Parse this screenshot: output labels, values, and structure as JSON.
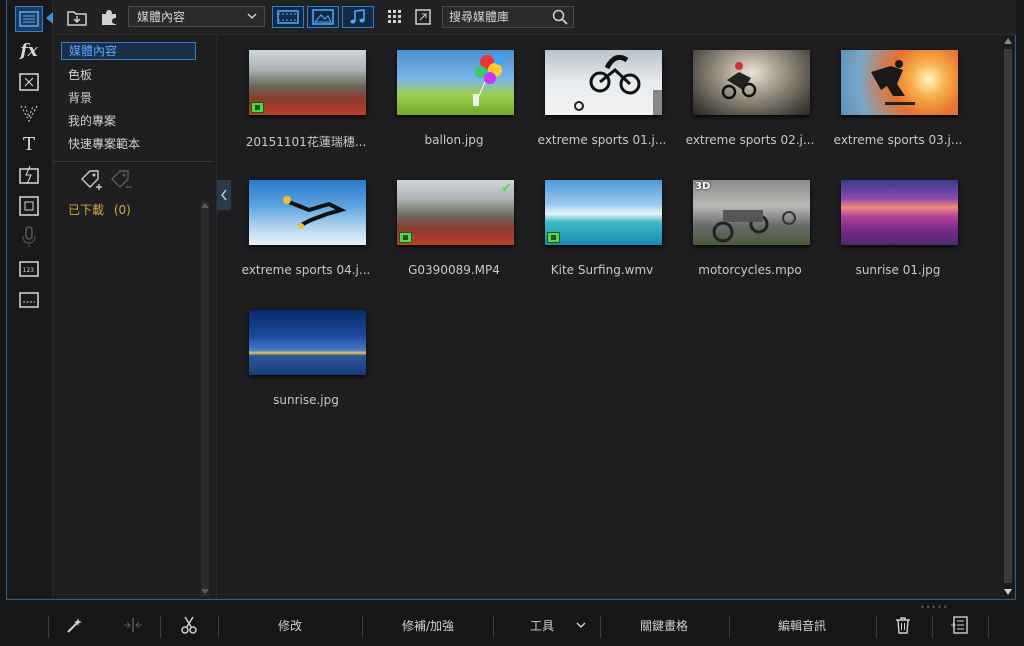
{
  "toolbar": {
    "dropdown_value": "媒體內容",
    "search_placeholder": "搜尋媒體庫"
  },
  "categories": {
    "items": [
      "媒體內容",
      "色板",
      "背景",
      "我的專案",
      "快速專案範本"
    ],
    "selected": 0,
    "downloaded_label": "已下載",
    "downloaded_count": "(0)"
  },
  "library": {
    "items": [
      {
        "name": "20151101花蓮瑞穗...",
        "type": "video"
      },
      {
        "name": "ballon.jpg",
        "type": "image"
      },
      {
        "name": "extreme sports 01.j...",
        "type": "image"
      },
      {
        "name": "extreme sports 02.j...",
        "type": "image"
      },
      {
        "name": "extreme sports 03.j...",
        "type": "image"
      },
      {
        "name": "extreme sports 04.j...",
        "type": "image"
      },
      {
        "name": "G0390089.MP4",
        "type": "video",
        "checked": true
      },
      {
        "name": "Kite Surfing.wmv",
        "type": "video"
      },
      {
        "name": "motorcycles.mpo",
        "type": "3d",
        "badge": "3D"
      },
      {
        "name": "sunrise 01.jpg",
        "type": "image"
      },
      {
        "name": "sunrise.jpg",
        "type": "image"
      }
    ]
  },
  "bottombar": {
    "modify": "修改",
    "fix_enhance": "修補/加強",
    "tools": "工具",
    "keyframe": "關鍵畫格",
    "edit_audio": "編輯音訊"
  },
  "colors": {
    "accent": "#2f7ed0",
    "selected_text": "#5aa8ff",
    "downloaded": "#d8a53a"
  }
}
